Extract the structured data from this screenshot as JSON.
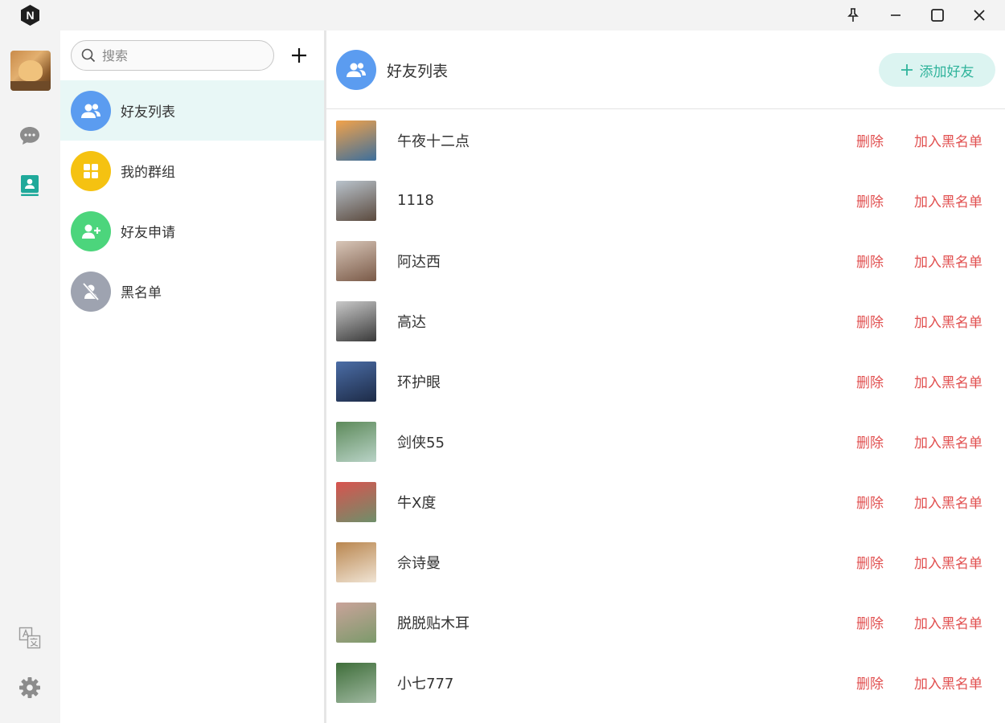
{
  "titlebar": {
    "logo_letter": "N"
  },
  "rail": {
    "items": [
      {
        "icon": "chat-icon"
      },
      {
        "icon": "contacts-icon",
        "active_color": "#1fa99a"
      },
      {
        "icon": "translate-icon"
      },
      {
        "icon": "gear-icon"
      }
    ]
  },
  "search": {
    "placeholder": "搜索",
    "value": ""
  },
  "menu": [
    {
      "label": "好友列表",
      "color": "#5b9cf0",
      "icon": "users-icon",
      "active": true
    },
    {
      "label": "我的群组",
      "color": "#f5c211",
      "icon": "grid-icon",
      "active": false
    },
    {
      "label": "好友申请",
      "color": "#4cd57c",
      "icon": "user-add-icon",
      "active": false
    },
    {
      "label": "黑名单",
      "color": "#9ea3b0",
      "icon": "user-blocked-icon",
      "active": false
    }
  ],
  "header": {
    "title": "好友列表",
    "add_button": "添加好友"
  },
  "actions": {
    "delete": "删除",
    "blacklist": "加入黑名单"
  },
  "friends": [
    {
      "name": "午夜十二点",
      "avatar_colors": [
        "#f2a24a",
        "#3d6f9c"
      ]
    },
    {
      "name": "1118",
      "avatar_colors": [
        "#b9c3cc",
        "#5b4a3e"
      ]
    },
    {
      "name": "阿达西",
      "avatar_colors": [
        "#d8c6b8",
        "#7a5a48"
      ]
    },
    {
      "name": "高达",
      "avatar_colors": [
        "#c9c9c9",
        "#3a3a3a"
      ]
    },
    {
      "name": "环护眼",
      "avatar_colors": [
        "#4b6da6",
        "#1d2b47"
      ]
    },
    {
      "name": "剑侠55",
      "avatar_colors": [
        "#5d8a5a",
        "#b9d3c7"
      ]
    },
    {
      "name": "牛X度",
      "avatar_colors": [
        "#d9534f",
        "#6e8f6a"
      ]
    },
    {
      "name": "佘诗曼",
      "avatar_colors": [
        "#b9864f",
        "#f0e4d4"
      ]
    },
    {
      "name": "脱脱贴木耳",
      "avatar_colors": [
        "#c9a39a",
        "#7c9a6b"
      ]
    },
    {
      "name": "小七777",
      "avatar_colors": [
        "#3f6e3a",
        "#9fb8a0"
      ]
    }
  ],
  "colors": {
    "accent": "#2fb39b",
    "danger": "#e15050",
    "active_bg": "#e8f7f6"
  }
}
